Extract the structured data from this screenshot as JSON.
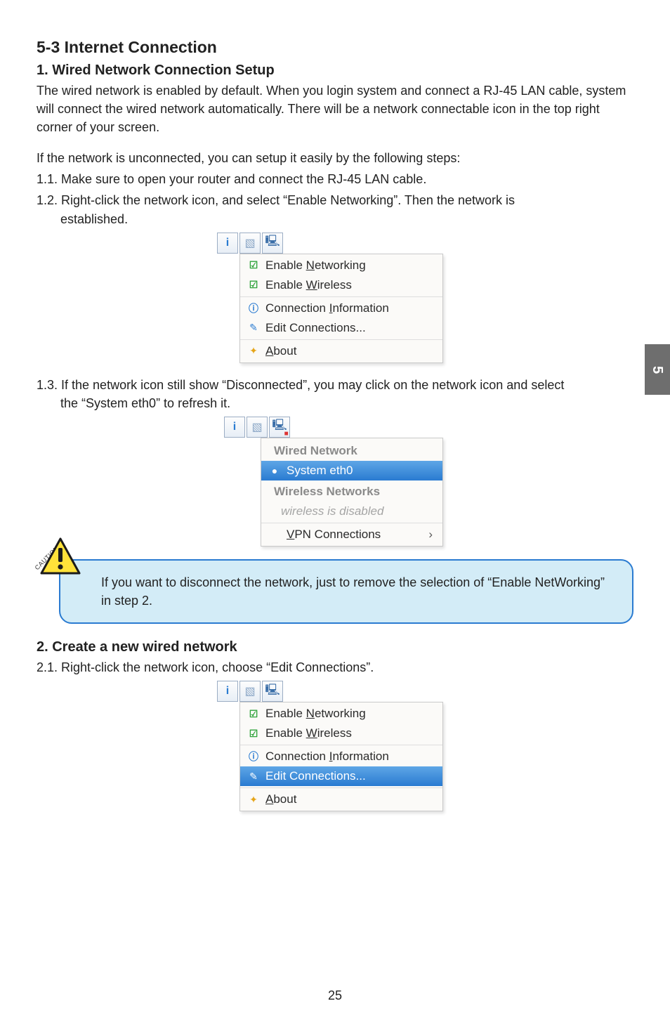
{
  "section_title": "5-3 Internet Connection",
  "sub1_title": "1. Wired Network Connection Setup",
  "sub1_para": "The wired network is enabled by default. When you login system and connect a RJ-45 LAN cable, system will connect the wired network automatically. There will be a network connectable icon in the top right corner of your screen.",
  "sub1_lead": "If the network is unconnected, you can setup it easily by the following steps:",
  "sub1_step1": "1.1. Make sure to open your router and connect the RJ-45 LAN cable.",
  "sub1_step2_a": "1.2. Right-click the network icon, and select “Enable Networking”.  Then the network is",
  "sub1_step2_b": "established.",
  "sub1_step3_a": "1.3. If the network icon still show “Disconnected”, you may click on the network icon and select",
  "sub1_step3_b": "the “System eth0” to refresh it.",
  "menu1": {
    "enable_networking": "Enable Networking",
    "enable_wireless": "Enable Wireless",
    "conn_info": "Connection Information",
    "edit_conn": "Edit Connections...",
    "about": "About"
  },
  "menu2": {
    "wired_header": "Wired Network",
    "system_eth0": "System eth0",
    "wireless_header": "Wireless Networks",
    "wireless_disabled": "wireless is disabled",
    "vpn": "VPN Connections"
  },
  "caution_label": "CAUTION",
  "caution_text": "If you want to disconnect the network, just to remove the selection of “Enable NetWorking” in step 2.",
  "sub2_title": "2. Create a new wired network",
  "sub2_step1": "2.1. Right-click the network icon, choose “Edit Connections”.",
  "chapter": "5",
  "page": "25"
}
